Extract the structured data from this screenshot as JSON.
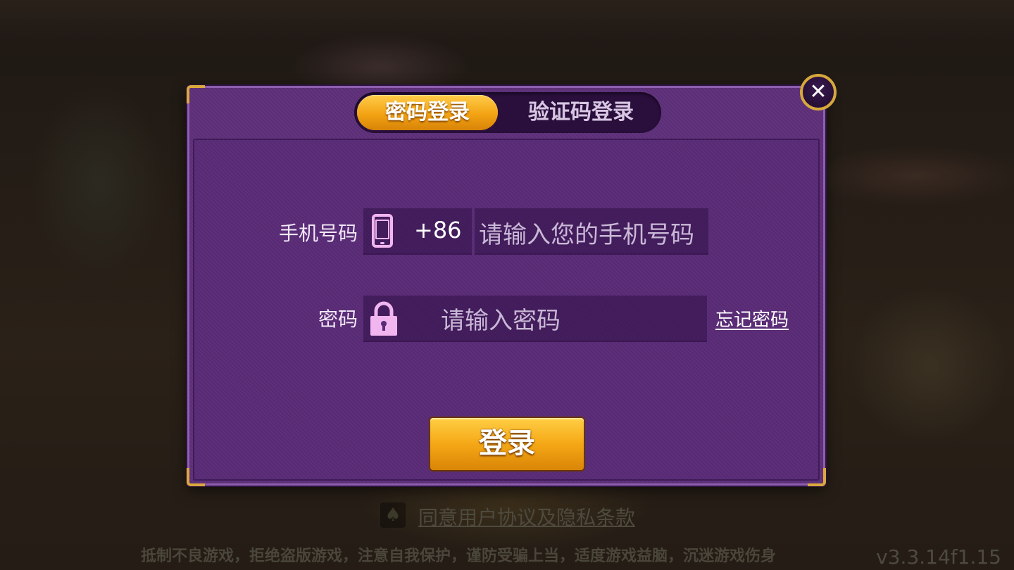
{
  "tabs": {
    "password_login": "密码登录",
    "code_login": "验证码登录"
  },
  "close_symbol": "✕",
  "phone_row": {
    "label": "手机号码",
    "country_code": "+86",
    "placeholder": "请输入您的手机号码"
  },
  "password_row": {
    "label": "密码",
    "placeholder": "请输入密码",
    "forgot": "忘记密码"
  },
  "login_button": "登录",
  "agreement": {
    "icon": "♠",
    "text": "同意用户协议及隐私条款"
  },
  "health_notice": "抵制不良游戏，拒绝盗版游戏，注意自我保护，谨防受骗上当，适度游戏益脑，沉迷游戏伤身",
  "version": "v3.3.14f1.15",
  "colors": {
    "accent_gold": "#f3a313",
    "panel_purple": "#5e2f7a",
    "icon_pink": "#f1b6f0"
  }
}
